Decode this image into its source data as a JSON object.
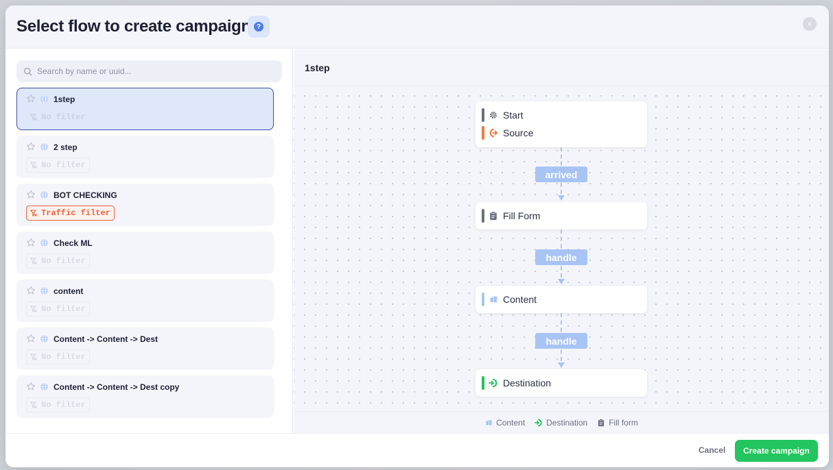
{
  "header": {
    "title": "Select flow to create campaign",
    "help_label": "?",
    "close_label": "×"
  },
  "search": {
    "placeholder": "Search by name or uuid...",
    "value": ""
  },
  "flows": [
    {
      "name": "1step",
      "filter": "No filter",
      "filter_type": "none",
      "selected": true
    },
    {
      "name": "2 step",
      "filter": "No filter",
      "filter_type": "none",
      "selected": false
    },
    {
      "name": "BOT CHECKING",
      "filter": "Traffic filter",
      "filter_type": "traffic",
      "selected": false
    },
    {
      "name": "Check ML",
      "filter": "No filter",
      "filter_type": "none",
      "selected": false
    },
    {
      "name": "content",
      "filter": "No filter",
      "filter_type": "none",
      "selected": false
    },
    {
      "name": "Content -> Content -> Dest",
      "filter": "No filter",
      "filter_type": "none",
      "selected": false
    },
    {
      "name": "Content -> Content -> Dest copy",
      "filter": "No filter",
      "filter_type": "none",
      "selected": false
    }
  ],
  "preview": {
    "title": "1step",
    "nodes": {
      "start": "Start",
      "source": "Source",
      "fill_form": "Fill Form",
      "content": "Content",
      "destination": "Destination"
    },
    "edges": [
      "arrived",
      "handle",
      "handle"
    ],
    "legend": {
      "content": "Content",
      "destination": "Destination",
      "fill_form": "Fill form"
    }
  },
  "footer": {
    "cancel_label": "Cancel",
    "create_label": "Create campaign"
  },
  "colors": {
    "accent_green": "#22c55e",
    "selected_border": "#3a4fa8",
    "traffic_orange": "#e8643c",
    "edge_blue": "#a8c4f5",
    "start_bar": "#6b6e80",
    "source_bar": "#f07a3c",
    "content_bar": "#a8c4f5",
    "destination_bar": "#22c55e"
  }
}
